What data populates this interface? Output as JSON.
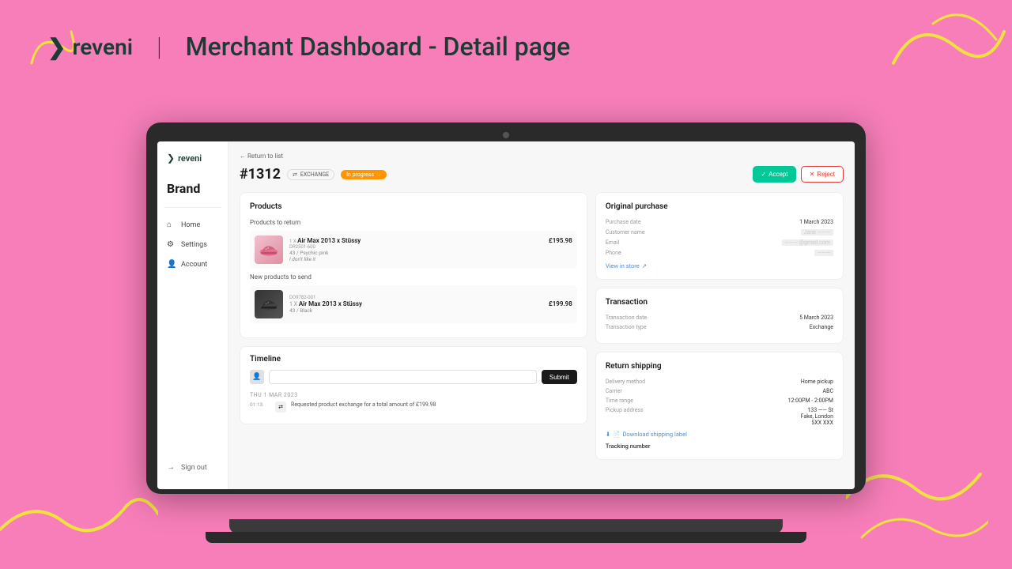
{
  "header": {
    "logo_text": "reveni",
    "divider": "|",
    "title": "Merchant Dashboard - Detail page"
  },
  "sidebar": {
    "brand_label": "Brand",
    "nav_items": [
      {
        "label": "Home",
        "icon": "🏠"
      },
      {
        "label": "Settings",
        "icon": "⚙"
      },
      {
        "label": "Account",
        "icon": "👤"
      },
      {
        "label": "Sign out",
        "icon": "→"
      }
    ]
  },
  "breadcrumb": "← Return to list",
  "order": {
    "number": "#1312",
    "exchange_label": "EXCHANGE",
    "status": "In progress →",
    "accept_label": "Accept",
    "reject_label": "Reject"
  },
  "products": {
    "section_title": "Products",
    "return_label": "Products to return",
    "return_item": {
      "qty": "1 X",
      "name": "Air Max 2013 x Stüssy",
      "sku": "DR2501-600",
      "price": "£195.98",
      "meta": "43 / Psychic pink",
      "reason": "I don't like it"
    },
    "send_label": "New products to send",
    "send_item": {
      "sku": "DO9782-001",
      "qty": "1 X",
      "name": "Air Max 2013 x Stüssy",
      "price": "£199.98",
      "meta": "43 / Black"
    }
  },
  "original_purchase": {
    "title": "Original purchase",
    "purchase_date_label": "Purchase date",
    "purchase_date_value": "1 March 2023",
    "customer_name_label": "Customer name",
    "customer_name_value": "Jane ———",
    "email_label": "Email",
    "email_value": "——— @gmail.com",
    "phone_label": "Phone",
    "phone_value": "———",
    "view_in_store": "View in store"
  },
  "transaction": {
    "title": "Transaction",
    "date_label": "Transaction date",
    "date_value": "5 March 2023",
    "type_label": "Transaction type",
    "type_value": "Exchange"
  },
  "return_shipping": {
    "title": "Return shipping",
    "delivery_label": "Delivery method",
    "delivery_value": "Home pickup",
    "carrier_label": "Carrier",
    "carrier_value": "ABC",
    "time_label": "Time range",
    "time_value": "12:00PM - 2:00PM",
    "address_label": "Pickup address",
    "address_line1": "133 —— St",
    "address_line2": "Fake, London",
    "address_line3": "5XX XXX",
    "download_label": "Download shipping label",
    "tracking_label": "Tracking number"
  },
  "timeline": {
    "title": "Timeline",
    "input_placeholder": "",
    "submit_label": "Submit",
    "date_label": "THU 1 MAR 2023",
    "event_time": "01:13",
    "event_text": "Requested product exchange for a total amount of £199.98"
  }
}
